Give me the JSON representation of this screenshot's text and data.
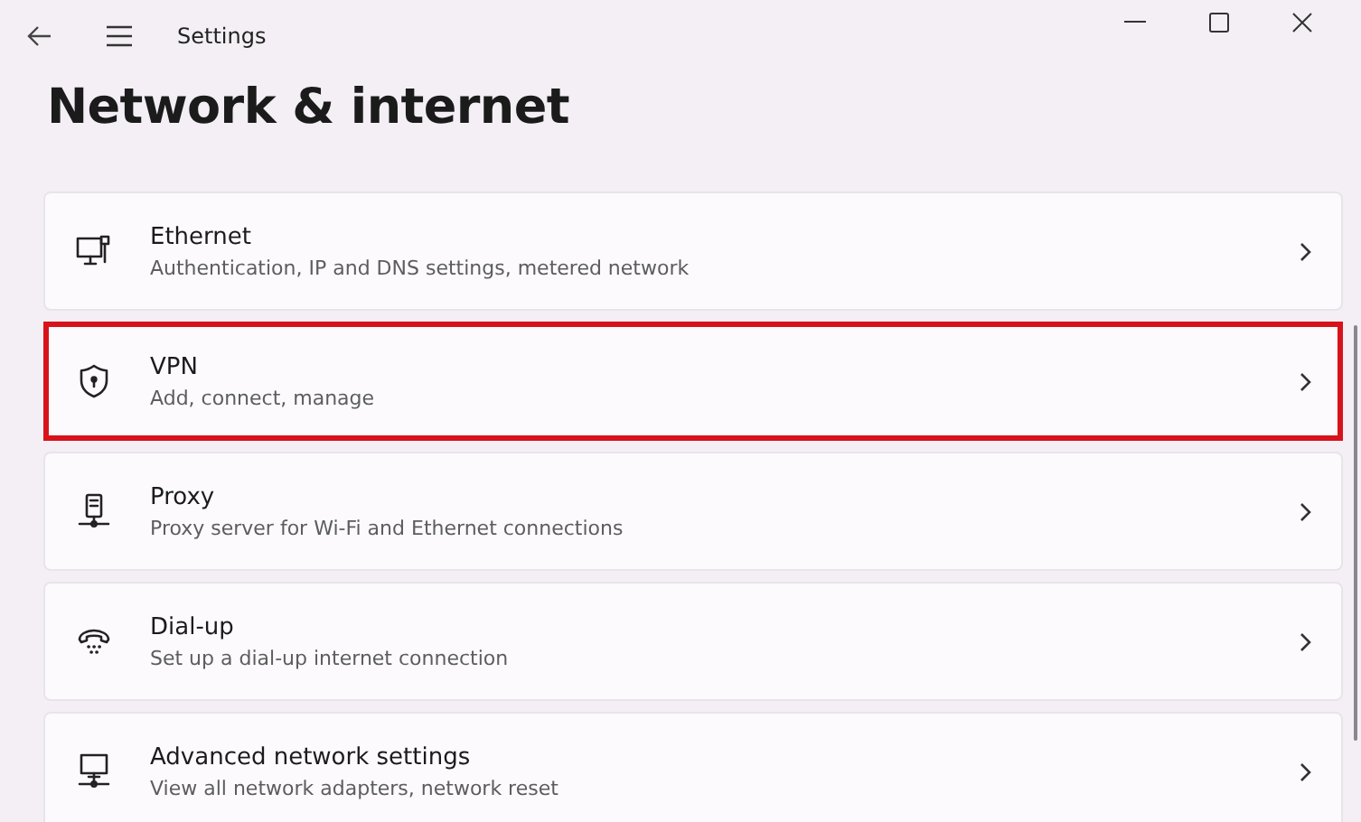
{
  "window": {
    "title": "Settings"
  },
  "page_title": "Network & internet",
  "items": [
    {
      "kind": "ethernet",
      "title": "Ethernet",
      "subtitle": "Authentication, IP and DNS settings, metered network",
      "highlighted": false
    },
    {
      "kind": "vpn",
      "title": "VPN",
      "subtitle": "Add, connect, manage",
      "highlighted": true
    },
    {
      "kind": "proxy",
      "title": "Proxy",
      "subtitle": "Proxy server for Wi-Fi and Ethernet connections",
      "highlighted": false
    },
    {
      "kind": "dialup",
      "title": "Dial-up",
      "subtitle": "Set up a dial-up internet connection",
      "highlighted": false
    },
    {
      "kind": "advanced",
      "title": "Advanced network settings",
      "subtitle": "View all network adapters, network reset",
      "highlighted": false
    }
  ]
}
